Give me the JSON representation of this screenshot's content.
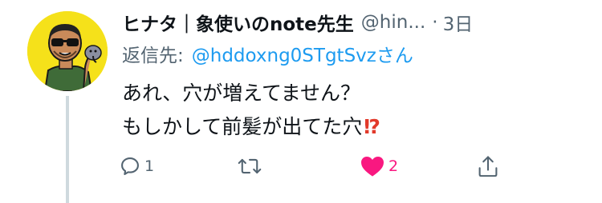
{
  "tweet": {
    "author": {
      "display_name": "ヒナタ｜象使いのnote先生",
      "handle": "@hin...",
      "avatar": "avatar-cartoon-man-with-sunglasses"
    },
    "separator": "·",
    "timestamp": "3日",
    "reply": {
      "label": "返信先:",
      "target": "@hddoxng0STgtSvzさん"
    },
    "text": {
      "line1": "あれ、穴が増えてません？",
      "line2": "もしかして前髪が出てた穴",
      "line2_emoji": "⁉"
    },
    "actions": {
      "reply": {
        "icon": "reply-icon",
        "count": "1"
      },
      "retweet": {
        "icon": "retweet-icon",
        "count": ""
      },
      "like": {
        "icon": "heart-icon",
        "count": "2",
        "liked": true,
        "color": "#f91880"
      },
      "share": {
        "icon": "share-icon"
      }
    },
    "colors": {
      "link": "#1d9bf0",
      "secondary_text": "#536471",
      "avatar_background": "#f5e11a"
    }
  }
}
